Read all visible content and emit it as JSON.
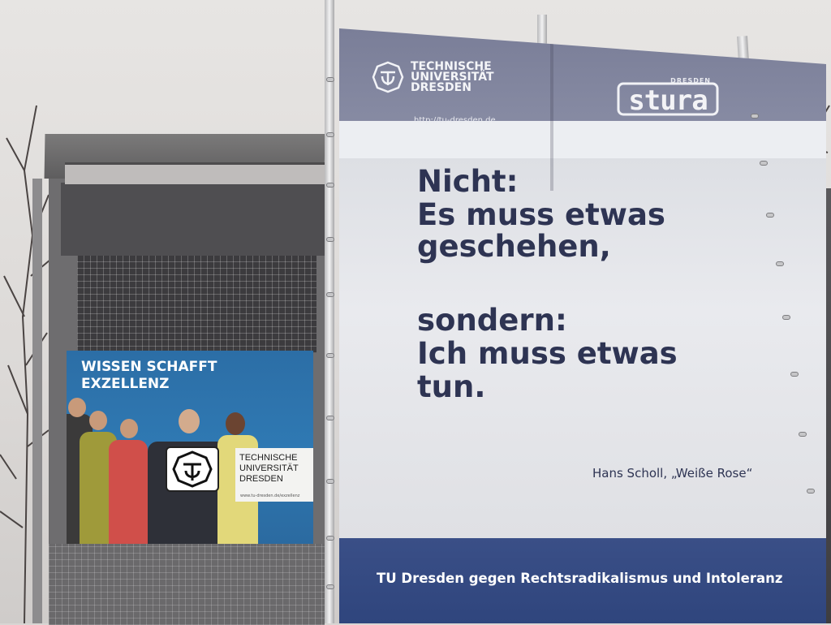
{
  "poster": {
    "title": "WISSEN SCHAFFT\nEXZELLENZ",
    "logo_lines": [
      "TECHNISCHE",
      "UNIVERSITÄT",
      "DRESDEN"
    ],
    "url": "www.tu-dresden.de/exzellenz"
  },
  "banner": {
    "logo_lines": [
      "TECHNISCHE",
      "UNIVERSITÄT",
      "DRESDEN"
    ],
    "url": "http://tu-dresden.de",
    "stura_city": "DRESDEN",
    "stura_word": "stura",
    "quote_lines": [
      "Nicht:",
      "Es muss etwas",
      "geschehen,",
      "sondern:",
      "Ich muss etwas",
      "tun."
    ],
    "attribution": "Hans Scholl, „Weiße Rose“",
    "footer": "TU Dresden gegen Rechtsradikalismus und Intoleranz"
  },
  "colors": {
    "banner_header": "#7a7e98",
    "quote_text": "#2e3453",
    "footer_band": "#2f457d",
    "poster_blue": "#2f79b3"
  },
  "icons": [
    "tu-dresden-emblem",
    "stura-logo"
  ]
}
